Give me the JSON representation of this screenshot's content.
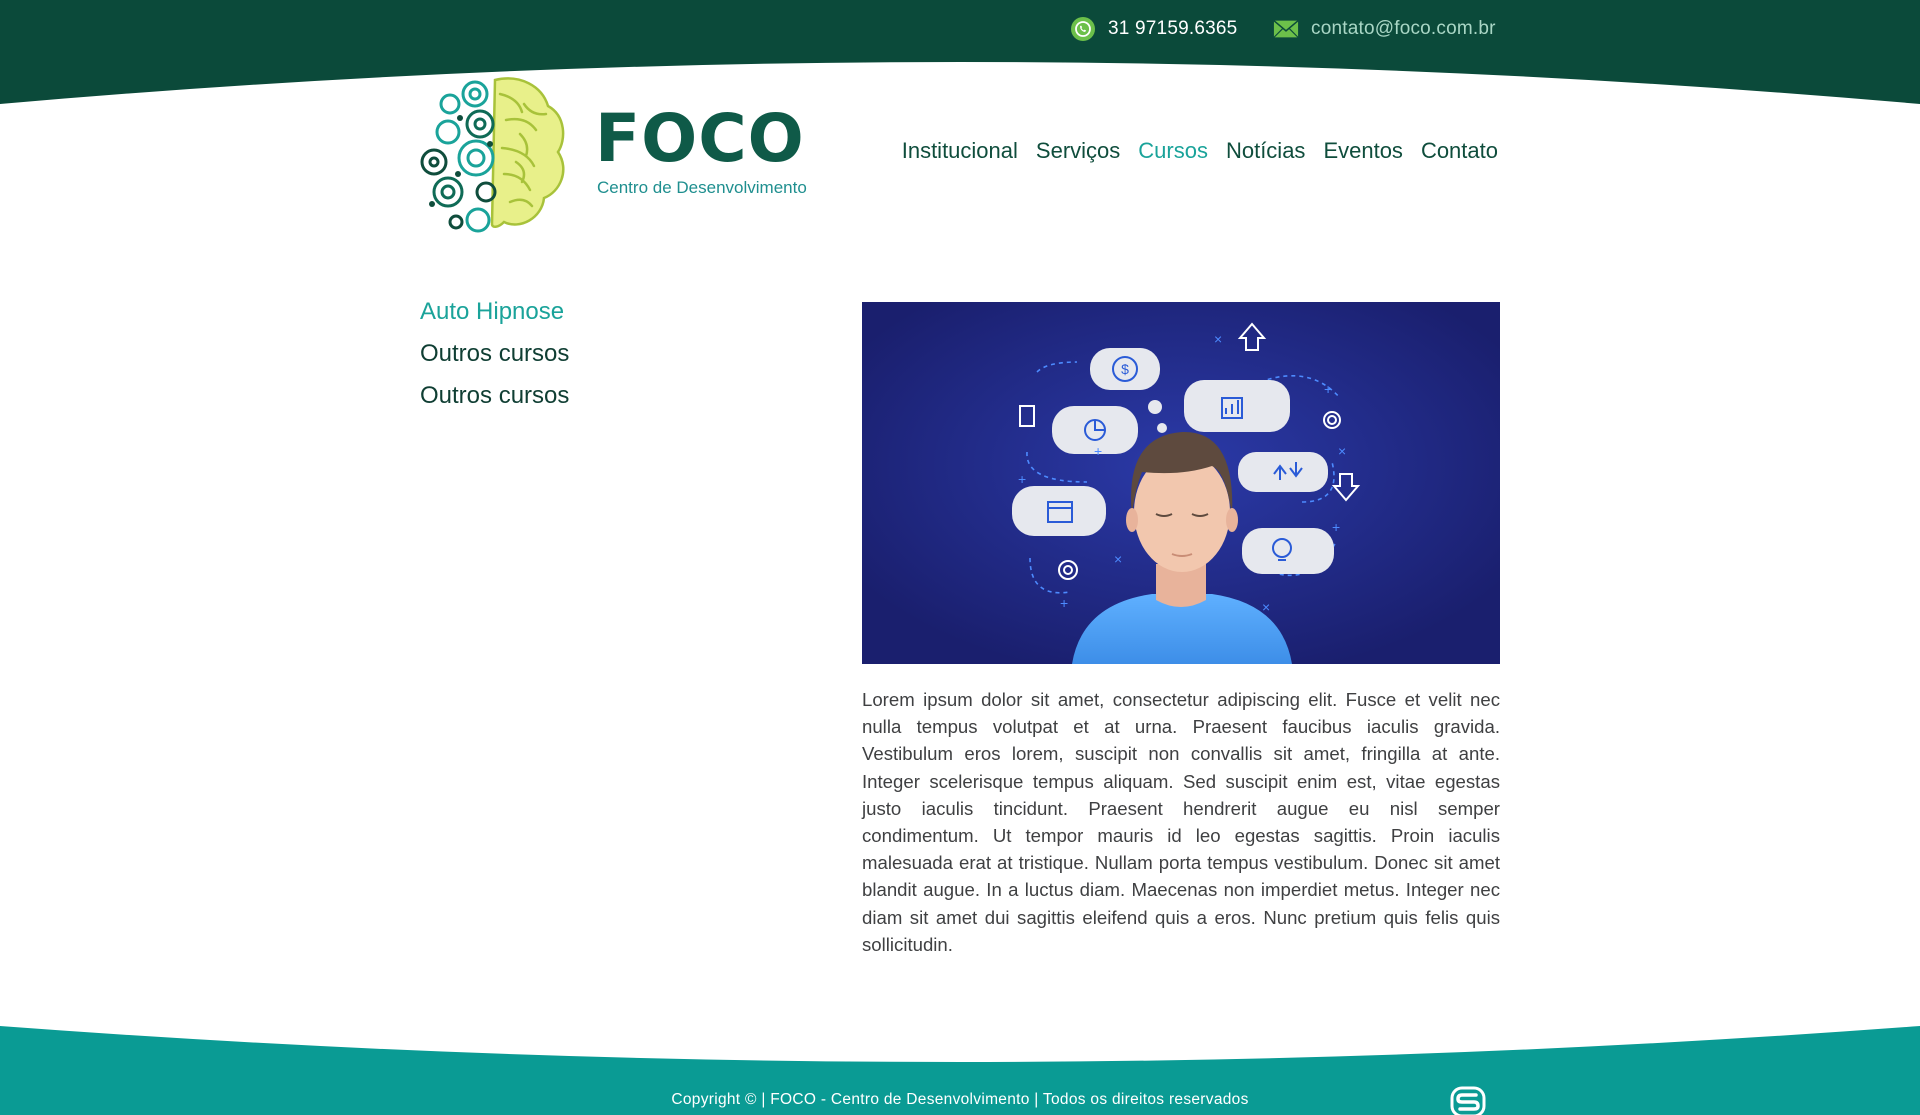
{
  "topbar": {
    "phone": "31 97159.6365",
    "email": "contato@foco.com.br",
    "phone_icon": "whatsapp-icon",
    "email_icon": "envelope-icon"
  },
  "brand": {
    "name": "FOCO",
    "tagline": "Centro de Desenvolvimento"
  },
  "nav": {
    "items": [
      {
        "label": "Institucional"
      },
      {
        "label": "Serviços"
      },
      {
        "label": "Cursos",
        "active": true
      },
      {
        "label": "Notícias"
      },
      {
        "label": "Eventos"
      },
      {
        "label": "Contato"
      }
    ]
  },
  "sidebar": {
    "items": [
      {
        "label": "Auto Hipnose",
        "active": true
      },
      {
        "label": "Outros cursos"
      },
      {
        "label": "Outros cursos"
      }
    ]
  },
  "main": {
    "body": "Lorem ipsum dolor sit amet, consectetur adipiscing elit. Fusce et velit nec nulla tempus volutpat et at urna. Praesent faucibus iaculis gravida. Vestibulum eros lorem, suscipit non convallis sit amet, fringilla at ante. Integer scelerisque tempus aliquam. Sed suscipit enim est, vitae egestas justo iaculis tincidunt. Praesent hendrerit augue eu nisl semper condimentum. Ut tempor mauris id leo egestas sagittis. Proin iaculis malesuada erat at tristique. Nullam porta tempus vestibulum. Donec sit amet blandit augue. In a luctus diam. Maecenas non imperdiet metus. Integer nec diam sit amet dui sagittis eleifend quis a eros. Nunc pretium quis felis quis sollicitudin."
  },
  "footer": {
    "copyright": "Copyright © | FOCO - Centro de Desenvolvimento | Todos os direitos reservados"
  },
  "colors": {
    "topbar": "#0b4a3a",
    "footer": "#0a9b94",
    "accent": "#1aa39a",
    "hero_bg": "#1c2378"
  }
}
